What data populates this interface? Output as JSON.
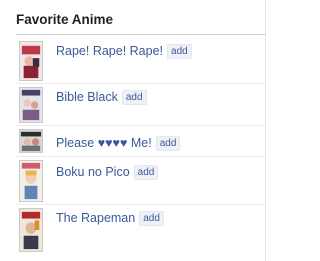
{
  "panel": {
    "title": "Favorite Anime",
    "add_label": "add",
    "items": [
      {
        "name": "Rape! Rape! Rape!",
        "thumb_icon": "anime-cover-thumbnail"
      },
      {
        "name": "Bible Black",
        "thumb_icon": "anime-cover-thumbnail"
      },
      {
        "name": "Please ♥♥♥♥ Me!",
        "thumb_icon": "anime-cover-thumbnail"
      },
      {
        "name": "Boku no Pico",
        "thumb_icon": "anime-cover-thumbnail"
      },
      {
        "name": "The Rapeman",
        "thumb_icon": "anime-cover-thumbnail"
      }
    ]
  }
}
